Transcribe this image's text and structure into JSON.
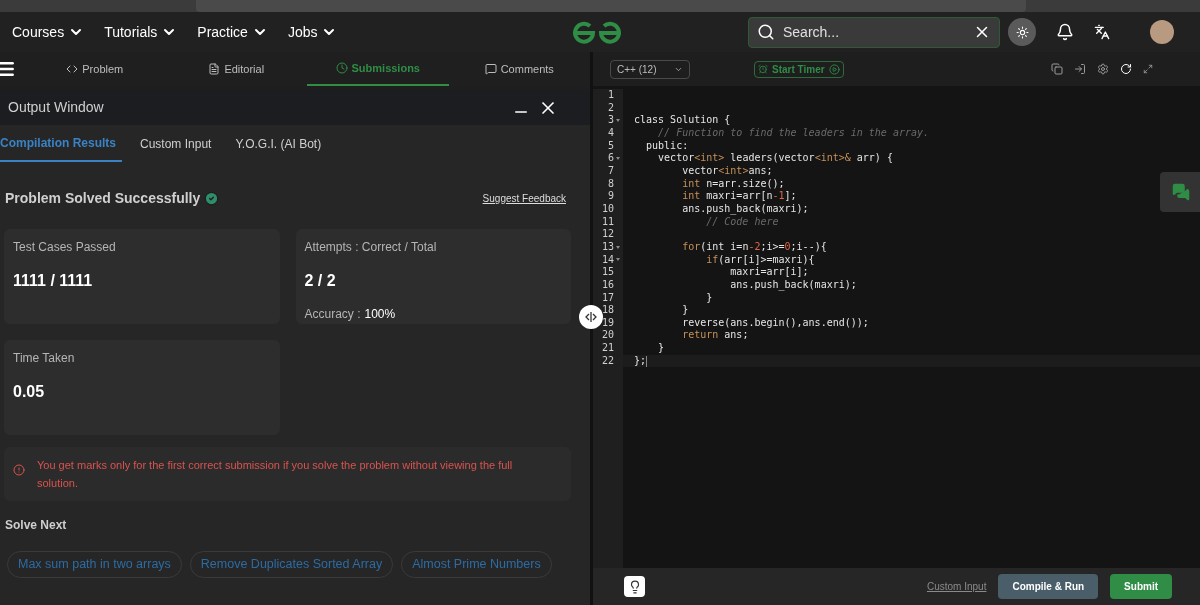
{
  "nav": {
    "menus": [
      {
        "label": "Courses"
      },
      {
        "label": "Tutorials"
      },
      {
        "label": "Practice"
      },
      {
        "label": "Jobs"
      }
    ],
    "search": {
      "placeholder": "Search..."
    }
  },
  "problem_tabs": [
    {
      "label": "Problem",
      "selected": false
    },
    {
      "label": "Editorial",
      "selected": false
    },
    {
      "label": "Submissions",
      "selected": true
    },
    {
      "label": "Comments",
      "selected": false
    }
  ],
  "output_window": {
    "title": "Output Window",
    "tabs": [
      {
        "label": "Compilation Results",
        "selected": true
      },
      {
        "label": "Custom Input",
        "selected": false
      },
      {
        "label": "Y.O.G.I. (AI Bot)",
        "selected": false
      }
    ],
    "status": "Problem Solved Successfully",
    "feedback_link": "Suggest Feedback",
    "cards": [
      {
        "label": "Test Cases Passed",
        "value": "1111 / 1111"
      },
      {
        "label": "Attempts : Correct / Total",
        "value": "2 / 2",
        "sub_label": "Accuracy :",
        "sub_value": "100%"
      },
      {
        "label": "Time Taken",
        "value": "0.05"
      }
    ],
    "notice": "You get marks only for the first correct submission if you solve the problem without viewing the full solution.",
    "solve_next": {
      "title": "Solve Next",
      "items": [
        "Max sum path in two arrays",
        "Remove Duplicates Sorted Array",
        "Almost Prime Numbers"
      ]
    }
  },
  "editor": {
    "language": "C++ (12)",
    "timer": "Start Timer",
    "lines": [
      {
        "no": "1",
        "fold": false,
        "current": false
      },
      {
        "no": "2",
        "fold": false,
        "current": false
      },
      {
        "no": "3",
        "fold": true,
        "current": false,
        "segments": [
          {
            "text": "class Solution {",
            "kind": "plain"
          }
        ]
      },
      {
        "no": "4",
        "fold": false,
        "current": false,
        "segments": [
          {
            "text": "    // Function to find the leaders in the array.",
            "kind": "comment"
          }
        ]
      },
      {
        "no": "5",
        "fold": false,
        "current": false,
        "segments": [
          {
            "text": "  public:",
            "kind": "plain"
          }
        ]
      },
      {
        "no": "6",
        "fold": true,
        "current": false,
        "segments": [
          {
            "text": "    vector",
            "kind": "plain"
          },
          {
            "text": "<int>",
            "kind": "type"
          },
          {
            "text": " leaders(vector",
            "kind": "plain"
          },
          {
            "text": "<int>&",
            "kind": "type"
          },
          {
            "text": " arr) {",
            "kind": "plain"
          }
        ]
      },
      {
        "no": "7",
        "fold": false,
        "current": false,
        "segments": [
          {
            "text": "        vector",
            "kind": "plain"
          },
          {
            "text": "<int>",
            "kind": "type"
          },
          {
            "text": "ans;",
            "kind": "plain"
          }
        ]
      },
      {
        "no": "8",
        "fold": false,
        "current": false,
        "segments": [
          {
            "text": "        int",
            "kind": "keyword"
          },
          {
            "text": " n=arr.size();",
            "kind": "plain"
          }
        ]
      },
      {
        "no": "9",
        "fold": false,
        "current": false,
        "segments": [
          {
            "text": "        int",
            "kind": "keyword"
          },
          {
            "text": " maxri=arr[n",
            "kind": "plain"
          },
          {
            "text": "-1",
            "kind": "number"
          },
          {
            "text": "];",
            "kind": "plain"
          }
        ]
      },
      {
        "no": "10",
        "fold": false,
        "current": false,
        "segments": [
          {
            "text": "        ans.push_back(maxri);",
            "kind": "plain"
          }
        ]
      },
      {
        "no": "11",
        "fold": false,
        "current": false,
        "segments": [
          {
            "text": "            // Code here",
            "kind": "comment"
          }
        ]
      },
      {
        "no": "12",
        "fold": false,
        "current": false
      },
      {
        "no": "13",
        "fold": true,
        "current": false,
        "segments": [
          {
            "text": "        for",
            "kind": "keyword"
          },
          {
            "text": "(int i=n",
            "kind": "plain"
          },
          {
            "text": "-2",
            "kind": "number"
          },
          {
            "text": ";i>=",
            "kind": "plain"
          },
          {
            "text": "0",
            "kind": "number"
          },
          {
            "text": ";i--){",
            "kind": "plain"
          }
        ]
      },
      {
        "no": "14",
        "fold": true,
        "current": false,
        "segments": [
          {
            "text": "            if",
            "kind": "keyword"
          },
          {
            "text": "(arr[i]>=maxri){",
            "kind": "plain"
          }
        ]
      },
      {
        "no": "15",
        "fold": false,
        "current": false,
        "segments": [
          {
            "text": "                maxri=arr[i];",
            "kind": "plain"
          }
        ]
      },
      {
        "no": "16",
        "fold": false,
        "current": false,
        "segments": [
          {
            "text": "                ans.push_back(maxri);",
            "kind": "plain"
          }
        ]
      },
      {
        "no": "17",
        "fold": false,
        "current": false,
        "segments": [
          {
            "text": "            }",
            "kind": "plain"
          }
        ]
      },
      {
        "no": "18",
        "fold": false,
        "current": false,
        "segments": [
          {
            "text": "        }",
            "kind": "plain"
          }
        ]
      },
      {
        "no": "19",
        "fold": false,
        "current": false,
        "segments": [
          {
            "text": "        reverse(ans.begin(),ans.end());",
            "kind": "plain"
          }
        ]
      },
      {
        "no": "20",
        "fold": false,
        "current": false,
        "segments": [
          {
            "text": "        return",
            "kind": "keyword"
          },
          {
            "text": " ans;",
            "kind": "plain"
          }
        ]
      },
      {
        "no": "21",
        "fold": false,
        "current": false,
        "segments": [
          {
            "text": "    }",
            "kind": "plain"
          }
        ]
      },
      {
        "no": "22",
        "fold": false,
        "current": true,
        "segments": [
          {
            "text": "};",
            "kind": "plain"
          }
        ]
      }
    ],
    "footer": {
      "custom_input": "Custom Input",
      "compile": "Compile & Run",
      "submit": "Submit"
    }
  }
}
